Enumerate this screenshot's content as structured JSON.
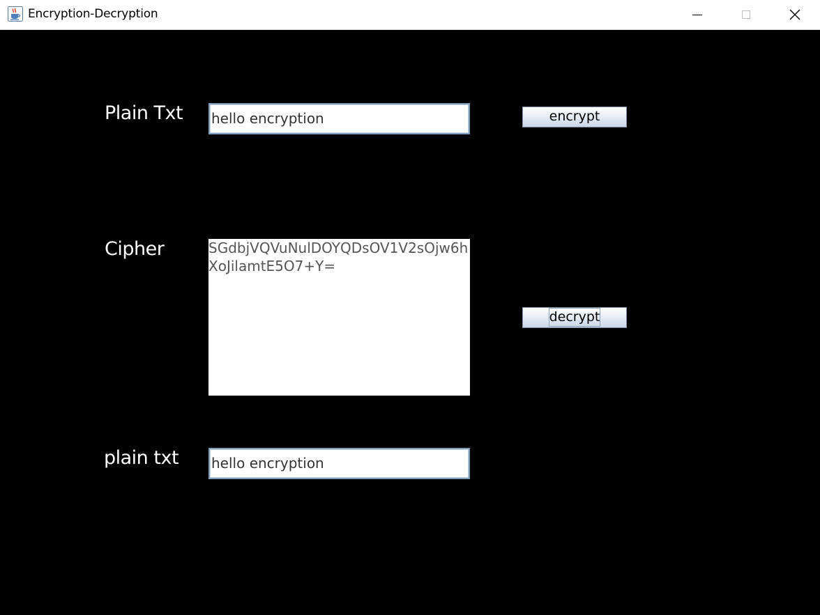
{
  "window": {
    "title": "Encryption-Decryption"
  },
  "form": {
    "plain_label": "Plain Txt",
    "plain_value": "hello encryption",
    "encrypt_label": "encrypt",
    "cipher_label": "Cipher",
    "cipher_value": "SGdbjVQVuNulDOYQDsOV1V2sOjw6hXoJilamtE5O7+Y=",
    "decrypt_label": "decrypt",
    "result_label": "plain txt",
    "result_value": "hello encryption"
  },
  "icons": {
    "app": "java-coffee-cup-icon",
    "minimize": "minimize-icon",
    "maximize": "maximize-icon",
    "close": "close-icon"
  }
}
